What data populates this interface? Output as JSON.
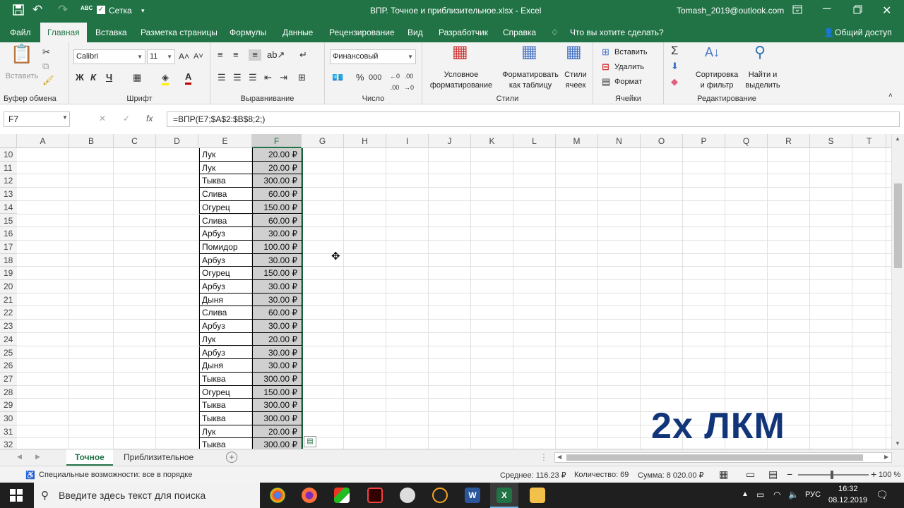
{
  "titlebar": {
    "save_icon": "💾",
    "undo_icon": "↶",
    "redo_icon": "↷",
    "spell_icon": "ABC",
    "grid_check": "Сетка",
    "doc_title": "ВПР. Точное и приблизительное.xlsx - Excel",
    "account": "Tomash_2019@outlook.com"
  },
  "tabs": {
    "file": "Файл",
    "home": "Главная",
    "insert": "Вставка",
    "layout": "Разметка страницы",
    "formulas": "Формулы",
    "data": "Данные",
    "review": "Рецензирование",
    "view": "Вид",
    "developer": "Разработчик",
    "help": "Справка",
    "tell": "Что вы хотите сделать?",
    "share": "Общий доступ"
  },
  "ribbon": {
    "paste": "Вставить",
    "clipboard": "Буфер обмена",
    "font_name": "Calibri",
    "font_size": "11",
    "bold": "Ж",
    "italic": "К",
    "underline": "Ч",
    "font_group": "Шрифт",
    "align_group": "Выравнивание",
    "number_format": "Финансовый",
    "number_group": "Число",
    "cond_format_1": "Условное",
    "cond_format_2": "форматирование",
    "format_table_1": "Форматировать",
    "format_table_2": "как таблицу",
    "cell_styles_1": "Стили",
    "cell_styles_2": "ячеек",
    "styles_group": "Стили",
    "insert": "Вставить",
    "delete": "Удалить",
    "format": "Формат",
    "cells_group": "Ячейки",
    "sort_1": "Сортировка",
    "sort_2": "и фильтр",
    "find_1": "Найти и",
    "find_2": "выделить",
    "edit_group": "Редактирование"
  },
  "formula_bar": {
    "name_box": "F7",
    "formula": "=ВПР(E7;$A$2:$B$8;2;)",
    "fx": "fx"
  },
  "columns": [
    "A",
    "B",
    "C",
    "D",
    "E",
    "F",
    "G",
    "H",
    "I",
    "J",
    "K",
    "L",
    "M",
    "N",
    "O",
    "P",
    "Q",
    "R",
    "S",
    "T"
  ],
  "rows": [
    {
      "n": "10",
      "e": "Лук",
      "f": "20.00 ₽"
    },
    {
      "n": "11",
      "e": "Лук",
      "f": "20.00 ₽"
    },
    {
      "n": "12",
      "e": "Тыква",
      "f": "300.00 ₽"
    },
    {
      "n": "13",
      "e": "Слива",
      "f": "60.00 ₽"
    },
    {
      "n": "14",
      "e": "Огурец",
      "f": "150.00 ₽"
    },
    {
      "n": "15",
      "e": "Слива",
      "f": "60.00 ₽"
    },
    {
      "n": "16",
      "e": "Арбуз",
      "f": "30.00 ₽"
    },
    {
      "n": "17",
      "e": "Помидор",
      "f": "100.00 ₽"
    },
    {
      "n": "18",
      "e": "Арбуз",
      "f": "30.00 ₽"
    },
    {
      "n": "19",
      "e": "Огурец",
      "f": "150.00 ₽"
    },
    {
      "n": "20",
      "e": "Арбуз",
      "f": "30.00 ₽"
    },
    {
      "n": "21",
      "e": "Дыня",
      "f": "30.00 ₽"
    },
    {
      "n": "22",
      "e": "Слива",
      "f": "60.00 ₽"
    },
    {
      "n": "23",
      "e": "Арбуз",
      "f": "30.00 ₽"
    },
    {
      "n": "24",
      "e": "Лук",
      "f": "20.00 ₽"
    },
    {
      "n": "25",
      "e": "Арбуз",
      "f": "30.00 ₽"
    },
    {
      "n": "26",
      "e": "Дыня",
      "f": "30.00 ₽"
    },
    {
      "n": "27",
      "e": "Тыква",
      "f": "300.00 ₽"
    },
    {
      "n": "28",
      "e": "Огурец",
      "f": "150.00 ₽"
    },
    {
      "n": "29",
      "e": "Тыква",
      "f": "300.00 ₽"
    },
    {
      "n": "30",
      "e": "Тыква",
      "f": "300.00 ₽"
    },
    {
      "n": "31",
      "e": "Лук",
      "f": "20.00 ₽"
    },
    {
      "n": "32",
      "e": "Тыква",
      "f": "300.00 ₽"
    }
  ],
  "sheets": {
    "active": "Точное",
    "other": "Приблизительное"
  },
  "status": {
    "accessibility": "Специальные возможности: все в порядке",
    "average": "Среднее:  116.23 ₽",
    "count": "Количество: 69",
    "sum": "Сумма:  8 020.00 ₽",
    "zoom": "100 %"
  },
  "taskbar": {
    "search": "Введите здесь текст для поиска",
    "lang": "РУС",
    "time": "16:32",
    "date": "08.12.2019"
  },
  "overlay": "2х ЛКМ",
  "colors": {
    "excel_green": "#217346",
    "overlay_blue": "#12357a"
  }
}
